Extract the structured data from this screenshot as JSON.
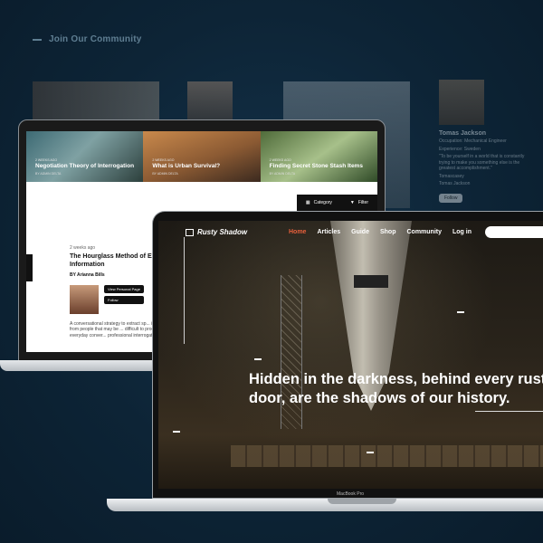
{
  "background": {
    "section_title": "Join Our Community",
    "profile": {
      "name": "Tomas Jackson",
      "role": "Occupation: Mechanical Engineer",
      "location": "Experience: Sweden",
      "quote": "\"To be yourself in a world that is constantly trying to make you something else is the greatest accomplishment.\"",
      "links": [
        "Tomascasey",
        "Tomas Jackson"
      ],
      "follow_label": "Follow"
    }
  },
  "blog": {
    "tiles": [
      {
        "date": "2 WEEKS AGO",
        "title": "Negotiation Theory of Interrogation",
        "by": "BY ADMIN DELTA"
      },
      {
        "date": "2 WEEKS AGO",
        "title": "What is Urban Survival?",
        "by": "BY ADMIN DELTA"
      },
      {
        "date": "2 WEEKS AGO",
        "title": "Finding Secret Stone Stash Items",
        "by": "BY ADMIN DELTA"
      }
    ],
    "filters": {
      "category": "Category",
      "filter": "Filter"
    },
    "article": {
      "ago": "2 weeks ago",
      "title": "The Hourglass Method of Ex... Information",
      "author": "BY Arianna Bills",
      "view_page": "View Personal Page",
      "follow": "Follow",
      "desc": "A conversational strategy to extract sp... information from people that may be ... difficult to procure in everyday conver... professional interrogation."
    }
  },
  "site": {
    "brand": "Rusty Shadow",
    "nav": [
      {
        "label": "Home",
        "active": true
      },
      {
        "label": "Articles",
        "active": false
      },
      {
        "label": "Guide",
        "active": false
      },
      {
        "label": "Shop",
        "active": false
      },
      {
        "label": "Community",
        "active": false
      },
      {
        "label": "Log in",
        "active": false
      }
    ],
    "headline_line1": "Hidden in the darkness, behind every rust",
    "headline_line2": "door, are the shadows of our history."
  },
  "device_label": "MacBook Pro",
  "colors": {
    "accent": "#e8603c",
    "background": "#0d2436"
  }
}
